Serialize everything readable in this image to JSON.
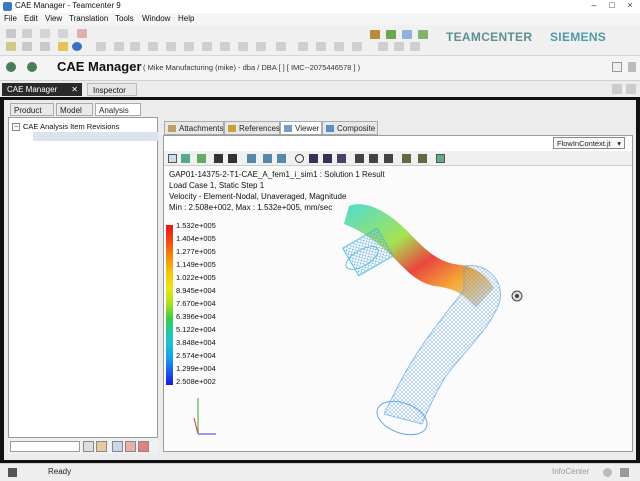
{
  "window": {
    "title": "CAE Manager - Teamcenter 9",
    "minimize": "–",
    "maximize": "□",
    "close": "×"
  },
  "menu": [
    "File",
    "Edit",
    "View",
    "Translation",
    "Tools",
    "Window",
    "Help"
  ],
  "brands": {
    "teamcenter": "TEAMCENTER",
    "siemens": "SIEMENS"
  },
  "perspective": {
    "title": "CAE Manager",
    "context": "( Mike Manufacturing (mike) - dba / DBA  [ ]  [ IMC--2075446578 ] )"
  },
  "view_tabs": {
    "cae": "CAE Manager",
    "inspector": "Inspector"
  },
  "sub_tabs": [
    "Product",
    "Model",
    "Analysis"
  ],
  "tree": {
    "root": "CAE Analysis Item Revisions"
  },
  "right_tabs": [
    "Attachments",
    "References",
    "Viewer",
    "Composite"
  ],
  "viewer_dropdown": "FlowInContext.jt",
  "result_info": [
    "GAP01-14375-2-T1-CAE_A_fem1_i_sim1 : Solution 1 Result",
    "Load Case 1, Static Step 1",
    "Velocity - Element-Nodal, Unaveraged, Magnitude",
    "Min : 2.508e+002, Max : 1.532e+005, mm/sec"
  ],
  "legend": [
    "1.532e+005",
    "1.404e+005",
    "1.277e+005",
    "1.149e+005",
    "1.022e+005",
    "8.945e+004",
    "7.670e+004",
    "6.396e+004",
    "5.122e+004",
    "3.848e+004",
    "2.574e+004",
    "1.299e+004",
    "2.508e+002"
  ],
  "status": {
    "text": "Ready",
    "info": "InfoCenter"
  },
  "colors": {
    "accent_dark": "#111111",
    "brand": "#5d8f94"
  }
}
